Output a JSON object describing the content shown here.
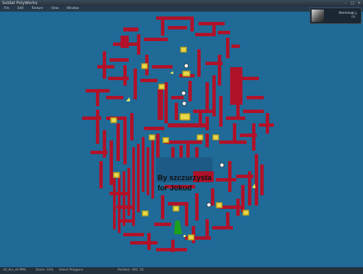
{
  "window": {
    "title": "Soldat PolyWorks",
    "controls": [
      "minimize-icon",
      "maximize-icon",
      "close-icon"
    ]
  },
  "menu": {
    "items": [
      "File",
      "Edit",
      "Texture",
      "View",
      "Window"
    ]
  },
  "map_text": {
    "line1": "By szczurzysta",
    "line2": "for Jokud"
  },
  "notification": {
    "name": "Banicious",
    "time": "1:31 OK"
  },
  "statusbar": {
    "file": "ctf_Aui_v0.PMS",
    "zoom": "Zoom: 33%",
    "tool": "Select Polygons",
    "position": "Position: 492, 56"
  },
  "colors": {
    "background": "#1f6a97",
    "wall": "#b0122a",
    "spawn": "#e8d84a",
    "spawn_border": "#b8a020",
    "flag_zone": "#1da01d"
  }
}
